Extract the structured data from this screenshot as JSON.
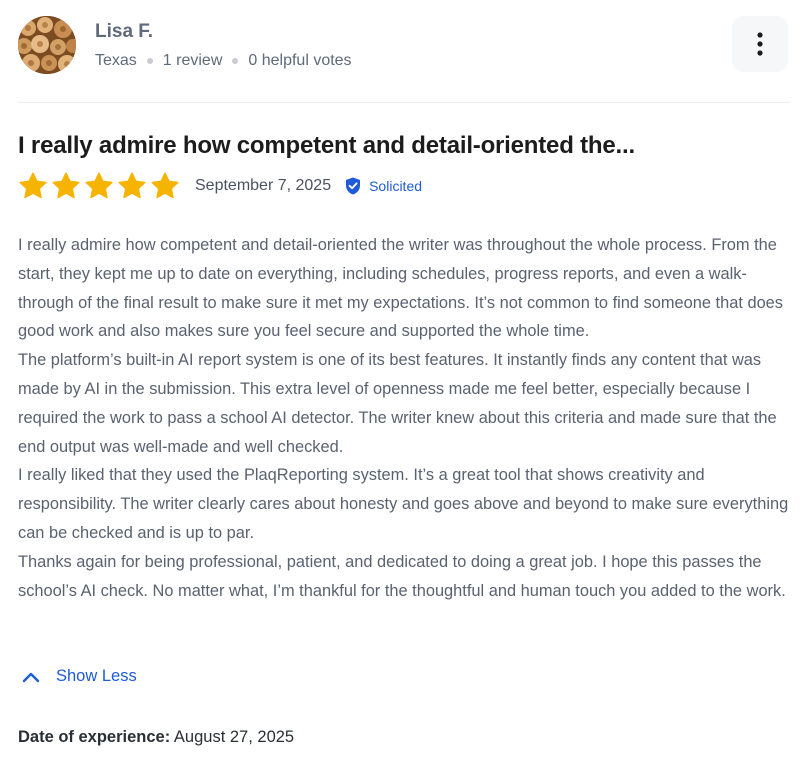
{
  "reviewer": {
    "name": "Lisa F.",
    "location": "Texas",
    "review_count": "1 review",
    "helpful_votes": "0 helpful votes",
    "avatar_icon": "firewood-avatar"
  },
  "menu": {
    "icon": "more-vertical-icon"
  },
  "review": {
    "title": "I really admire how competent and detail-oriented the...",
    "rating": 5,
    "rating_max": 5,
    "star_color": "#f6b300",
    "date": "September 7, 2025",
    "badge_label": "Solicited",
    "badge_icon": "shield-check-icon",
    "accent_color": "#1f5bd6",
    "paragraphs": [
      "I really admire how competent and detail-oriented the writer was throughout the whole process. From the start, they kept me up to date on everything, including schedules, progress reports, and even a walk-through of the final result to make sure it met my expectations. It’s not common to find someone that does good work and also makes sure you feel secure and supported the whole time.",
      "The platform’s built-in AI report system is one of its best features. It instantly finds any content that was made by AI in the submission. This extra level of openness made me feel better, especially because I required the work to pass a school AI detector. The writer knew about this criteria and made sure that the end output was well-made and well checked.",
      "I really liked that they used the PlaqReporting system. It’s a great tool that shows creativity and responsibility. The writer clearly cares about honesty and goes above and beyond to make sure everything can be checked and is up to par.",
      "Thanks again for being professional, patient, and dedicated to doing a great job. I hope this passes the school’s AI check. No matter what, I’m thankful for the thoughtful and human touch you added to the work."
    ],
    "show_less_label": "Show Less",
    "experience_label": "Date of experience:",
    "experience_date": "August 27, 2025"
  }
}
